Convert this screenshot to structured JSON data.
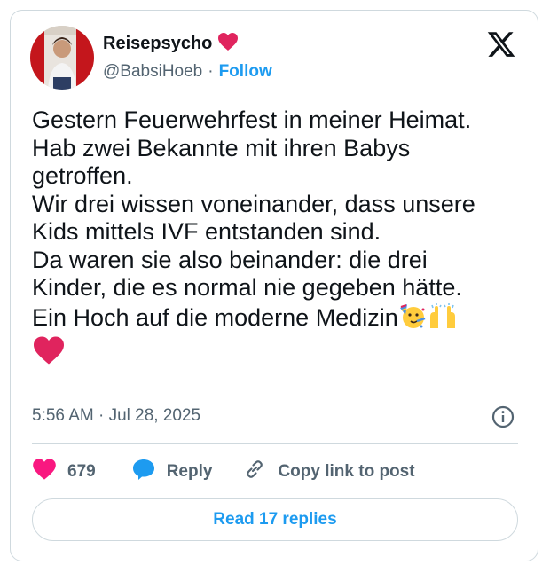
{
  "author": {
    "display_name": "Reisepsycho",
    "handle": "@BabsiHoeb",
    "separator": "·",
    "follow_label": "Follow"
  },
  "tweet": {
    "lines": [
      "Gestern Feuerwehrfest in meiner Heimat.",
      "Hab zwei Bekannte mit ihren Babys",
      "getroffen.",
      "Wir drei wissen voneinander, dass unsere",
      "Kids mittels IVF entstanden sind.",
      "Da waren sie also beinander: die drei",
      "Kinder, die es normal nie gegeben hätte.",
      "Ein Hoch auf die moderne Medizin"
    ],
    "trailing_emojis": [
      "partying-face-icon",
      "raised-hands-icon",
      "red-heart-icon"
    ],
    "timestamp": "5:56 AM · Jul 28, 2025"
  },
  "actions": {
    "like_count": "679",
    "reply_label": "Reply",
    "copy_label": "Copy link to post"
  },
  "read_replies_label": "Read 17 replies",
  "colors": {
    "accent": "#1d9bf0",
    "like": "#f91880",
    "heart": "#e0245e",
    "text": "#0f1419",
    "muted": "#536471",
    "border": "#cfd9de"
  }
}
